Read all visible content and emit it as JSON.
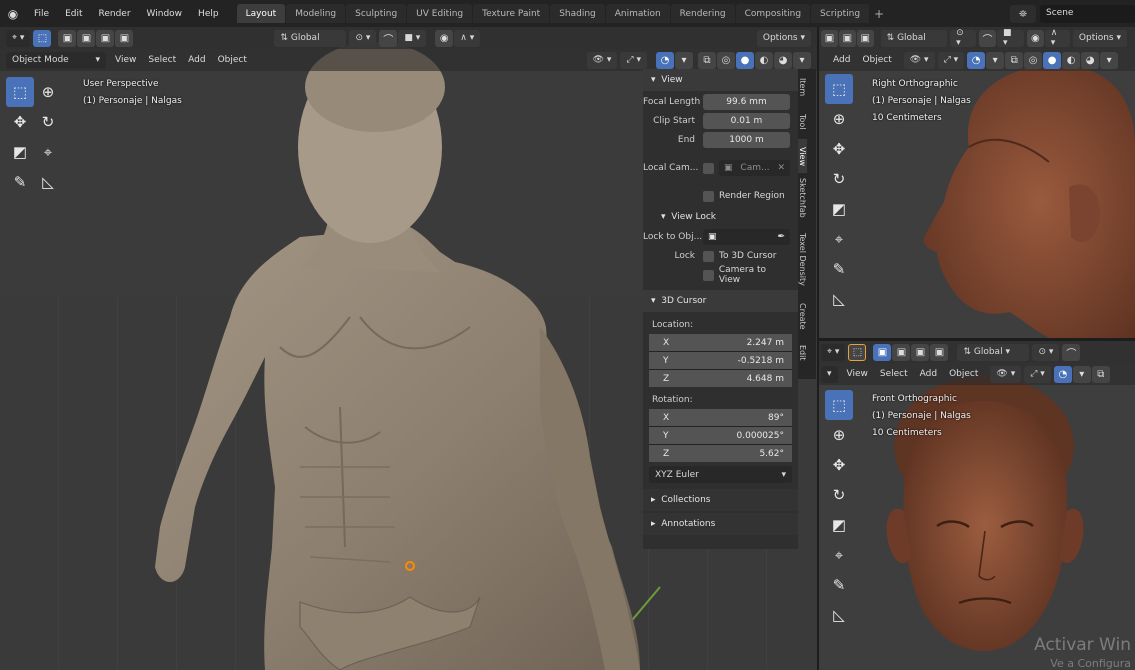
{
  "menubar": {
    "items": [
      "File",
      "Edit",
      "Render",
      "Window",
      "Help"
    ],
    "workspaces": [
      "Layout",
      "Modeling",
      "Sculpting",
      "UV Editing",
      "Texture Paint",
      "Shading",
      "Animation",
      "Rendering",
      "Compositing",
      "Scripting"
    ],
    "active_workspace": "Layout",
    "scene_field": "Scene"
  },
  "main_viewport": {
    "mode": "Object Mode",
    "menus": [
      "View",
      "Select",
      "Add",
      "Object"
    ],
    "orientation": "Global",
    "options": "Options",
    "overlay_title": "User Perspective",
    "overlay_object": "(1) Personaje | Nalgas"
  },
  "npanel": {
    "tabs": [
      "Item",
      "Tool",
      "View",
      "Sketchfab",
      "Texel Density",
      "Create",
      "Edit"
    ],
    "active_tab": "View",
    "view": {
      "header": "View",
      "focal_length_label": "Focal Length",
      "focal_length": "99.6 mm",
      "clip_start_label": "Clip Start",
      "clip_start": "0.01 m",
      "end_label": "End",
      "end": "1000 m",
      "local_camera_label": "Local Cam...",
      "local_camera_value": "Cam...",
      "render_region": "Render Region",
      "view_lock_header": "View Lock",
      "lock_to_object_label": "Lock to Obj...",
      "lock_label": "Lock",
      "to_3d_cursor": "To 3D Cursor",
      "camera_to_view": "Camera to View"
    },
    "cursor": {
      "header": "3D Cursor",
      "location_label": "Location:",
      "location": [
        {
          "axis": "X",
          "value": "2.247 m"
        },
        {
          "axis": "Y",
          "value": "-0.5218 m"
        },
        {
          "axis": "Z",
          "value": "4.648 m"
        }
      ],
      "rotation_label": "Rotation:",
      "rotation": [
        {
          "axis": "X",
          "value": "89°"
        },
        {
          "axis": "Y",
          "value": "0.000025°"
        },
        {
          "axis": "Z",
          "value": "5.62°"
        }
      ],
      "rotation_mode": "XYZ Euler"
    },
    "collections": "Collections",
    "annotations": "Annotations"
  },
  "right_top_viewport": {
    "menus": [
      "Add",
      "Object"
    ],
    "orientation": "Global",
    "options": "Options",
    "overlay_title": "Right Orthographic",
    "overlay_object": "(1) Personaje | Nalgas",
    "overlay_scale": "10 Centimeters"
  },
  "right_bottom_viewport": {
    "menus": [
      "View",
      "Select",
      "Add",
      "Object"
    ],
    "orientation": "Global",
    "overlay_title": "Front Orthographic",
    "overlay_object": "(1) Personaje | Nalgas",
    "overlay_scale": "10 Centimeters"
  },
  "watermark": {
    "line1": "Activar Win",
    "line2": "Ve a Configura"
  }
}
